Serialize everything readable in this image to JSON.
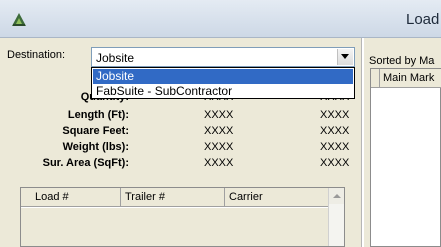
{
  "window": {
    "title": "Load",
    "icon": "app-logo-icon"
  },
  "destination": {
    "label": "Destination:",
    "selected": "Jobsite",
    "options": [
      "Jobsite",
      "FabSuite - SubContractor"
    ],
    "highlighted_option": "Jobsite"
  },
  "stats": [
    {
      "label": "Quantity:",
      "value1": "XXXX",
      "value2": "XXXX"
    },
    {
      "label": "Length (Ft):",
      "value1": "XXXX",
      "value2": "XXXX"
    },
    {
      "label": "Square Feet:",
      "value1": "XXXX",
      "value2": "XXXX"
    },
    {
      "label": "Weight (lbs):",
      "value1": "XXXX",
      "value2": "XXXX"
    },
    {
      "label": "Sur. Area (SqFt):",
      "value1": "XXXX",
      "value2": "XXXX"
    }
  ],
  "loads_grid": {
    "columns": [
      "Load #",
      "Trailer #",
      "Carrier"
    ]
  },
  "right_panel": {
    "sorted_label": "Sorted by Ma",
    "columns": [
      "Main Mark"
    ]
  },
  "colors": {
    "selection": "#316ac5",
    "panel": "#ece9d8"
  }
}
